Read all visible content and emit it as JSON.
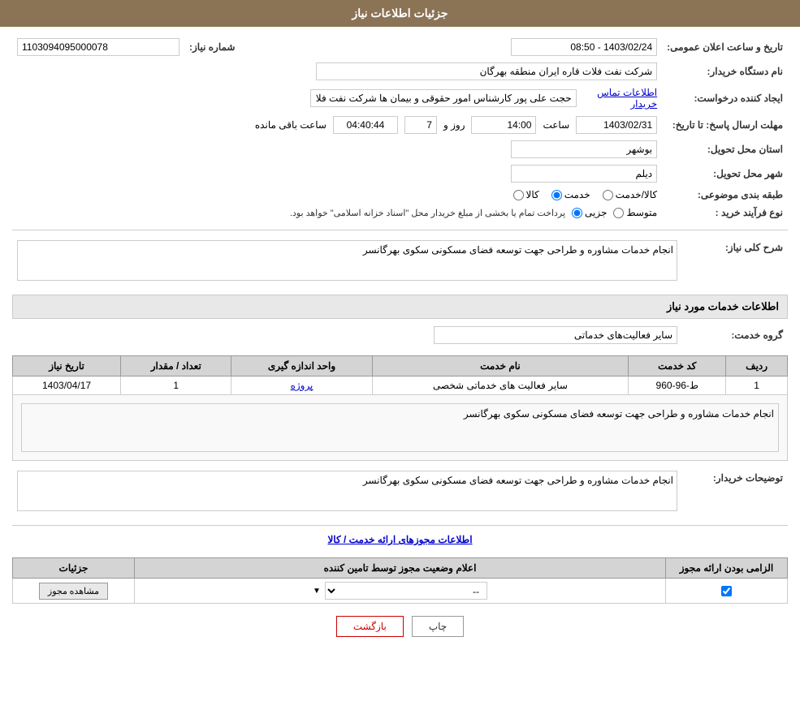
{
  "header": {
    "title": "جزئیات اطلاعات نیاز"
  },
  "fields": {
    "shomareNiaz_label": "شماره نیاز:",
    "shomareNiaz_value": "1103094095000078",
    "namDastgah_label": "نام دستگاه خریدار:",
    "namDastgah_value": "شرکت نفت فلات قاره ایران منطقه بهرگان",
    "ijadKonande_label": "ایجاد کننده درخواست:",
    "ijadKonande_value": "حجت علی پور کارشناس امور حقوقی و بیمان ها شرکت نفت فلات قاره ایران مند",
    "mohlat_label": "مهلت ارسال پاسخ: تا تاریخ:",
    "mohlat_date": "1403/02/31",
    "mohlat_time_label": "ساعت",
    "mohlat_time": "14:00",
    "mohlat_day_label": "روز و",
    "mohlat_days": "7",
    "mohlat_remaining_label": "ساعت باقی مانده",
    "mohlat_remaining": "04:40:44",
    "tarikh_label": "تاریخ و ساعت اعلان عمومی:",
    "tarikh_value": "1403/02/24 - 08:50",
    "ostan_label": "استان محل تحویل:",
    "ostan_value": "بوشهر",
    "shahr_label": "شهر محل تحویل:",
    "shahr_value": "دیلم",
    "tabaqe_label": "طبقه بندی موضوعی:",
    "tabaqe_kala": "کالا",
    "tabaqe_khedmat": "خدمت",
    "tabaqe_kala_khedmat": "کالا/خدمت",
    "noeFarayand_label": "نوع فرآیند خرید :",
    "noeFarayand_jazii": "جزیی",
    "noeFarayand_motavasset": "متوسط",
    "noeFarayand_note": "پرداخت تمام یا بخشی از مبلغ خریدار محل \"اسناد خزانه اسلامی\" خواهد بود.",
    "etelasat_tamas_link": "اطلاعات تماس خریدار",
    "sharh_section": "شرح کلی نیاز:",
    "sharh_value": "انجام خدمات مشاوره و طراحی جهت توسعه فضای مسکونی سکوی بهرگانسر",
    "khadamat_section": "اطلاعات خدمات مورد نیاز",
    "grouh_label": "گروه خدمت:",
    "grouh_value": "سایر فعالیت‌های خدماتی",
    "table": {
      "headers": [
        "ردیف",
        "کد خدمت",
        "نام خدمت",
        "واحد اندازه گیری",
        "تعداد / مقدار",
        "تاریخ نیاز"
      ],
      "rows": [
        {
          "radif": "1",
          "kod": "ط-96-960",
          "name": "سایر فعالیت های خدماتی شخصی",
          "vahad": "پروژه",
          "tedad": "1",
          "tarikh": "1403/04/17"
        }
      ]
    },
    "buyer_desc_label": "توضیحات خریدار:",
    "buyer_desc_value": "انجام خدمات مشاوره و طراحی جهت توسعه فضای مسکونی سکوی بهرگانسر",
    "mojavez_section_link": "اطلاعات مجوزهای ارائه خدمت / کالا",
    "mojavez_table": {
      "headers": [
        "الزامی بودن ارائه مجوز",
        "اعلام وضعیت مجوز توسط تامین کننده",
        "جزئیات"
      ],
      "rows": [
        {
          "elzami": "checkbox",
          "status": "--",
          "detail": "مشاهده مجوز"
        }
      ]
    },
    "print_btn": "چاپ",
    "back_btn": "بازگشت"
  }
}
